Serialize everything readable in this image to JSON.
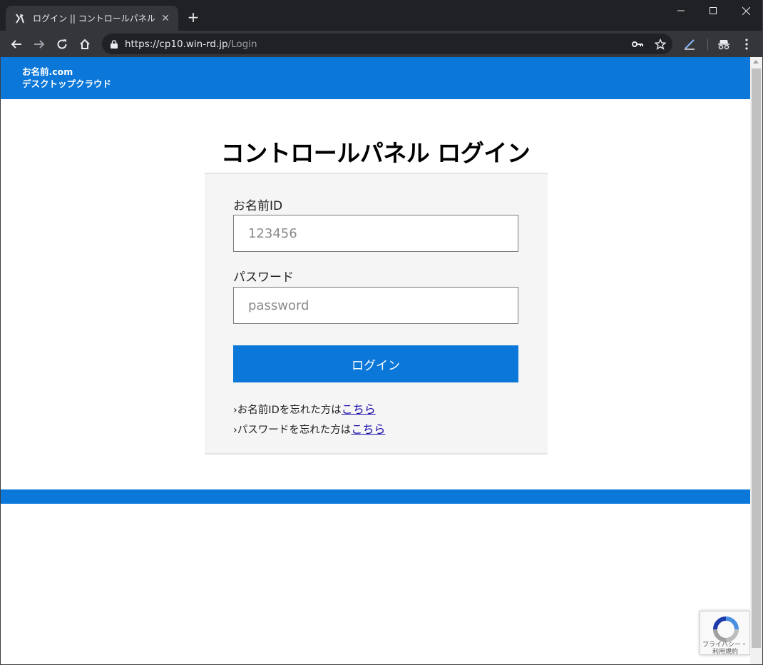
{
  "browser": {
    "tab_title": "ログイン || コントロールパネル",
    "url_host": "https://cp10.win-rd.jp",
    "url_path": "/Login",
    "new_tab_glyph": "+",
    "tab_close_glyph": "✕"
  },
  "site": {
    "brand_line1": "お名前.com",
    "brand_line2": "デスクトップクラウド",
    "accent_color": "#0b77d9"
  },
  "login": {
    "title": "コントロールパネル ログイン",
    "id_label": "お名前ID",
    "id_placeholder": "123456",
    "password_label": "パスワード",
    "password_placeholder": "password",
    "submit_label": "ログイン",
    "forgot_id_prefix": "›お名前IDを忘れた方は",
    "forgot_id_link": "こちら",
    "forgot_password_prefix": "›パスワードを忘れた方は",
    "forgot_password_link": "こちら"
  },
  "recaptcha": {
    "line1": "プライバシー・",
    "line2": "利用規約"
  }
}
